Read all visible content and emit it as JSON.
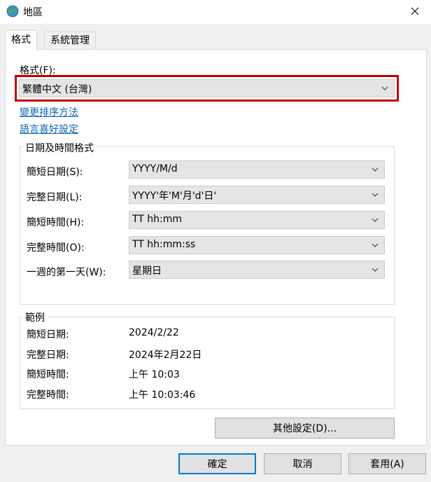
{
  "window": {
    "title": "地區",
    "icon": "globe-icon",
    "close_icon": "close-icon"
  },
  "tabs": [
    {
      "label": "格式",
      "active": true
    },
    {
      "label": "系統管理",
      "active": false
    }
  ],
  "format": {
    "label": "格式(F):",
    "selected": "繁體中文 (台灣)",
    "highlight_color": "#c00000"
  },
  "links": {
    "sort_method": "變更排序方法",
    "language_prefs": "語言喜好設定"
  },
  "datetime_group": {
    "caption": "日期及時間格式",
    "rows": [
      {
        "label": "簡短日期(S):",
        "value": "YYYY/M/d"
      },
      {
        "label": "完整日期(L):",
        "value": "YYYY'年'M'月'd'日'"
      },
      {
        "label": "簡短時間(H):",
        "value": "TT hh:mm"
      },
      {
        "label": "完整時間(O):",
        "value": "TT hh:mm:ss"
      },
      {
        "label": "一週的第一天(W):",
        "value": "星期日"
      }
    ]
  },
  "examples_group": {
    "caption": "範例",
    "rows": [
      {
        "label": "簡短日期:",
        "value": "2024/2/22"
      },
      {
        "label": "完整日期:",
        "value": "2024年2月22日"
      },
      {
        "label": "簡短時間:",
        "value": "上午 10:03"
      },
      {
        "label": "完整時間:",
        "value": "上午 10:03:46"
      }
    ]
  },
  "buttons": {
    "other_settings": "其他設定(D)...",
    "ok": "確定",
    "cancel": "取消",
    "apply": "套用(A)"
  }
}
